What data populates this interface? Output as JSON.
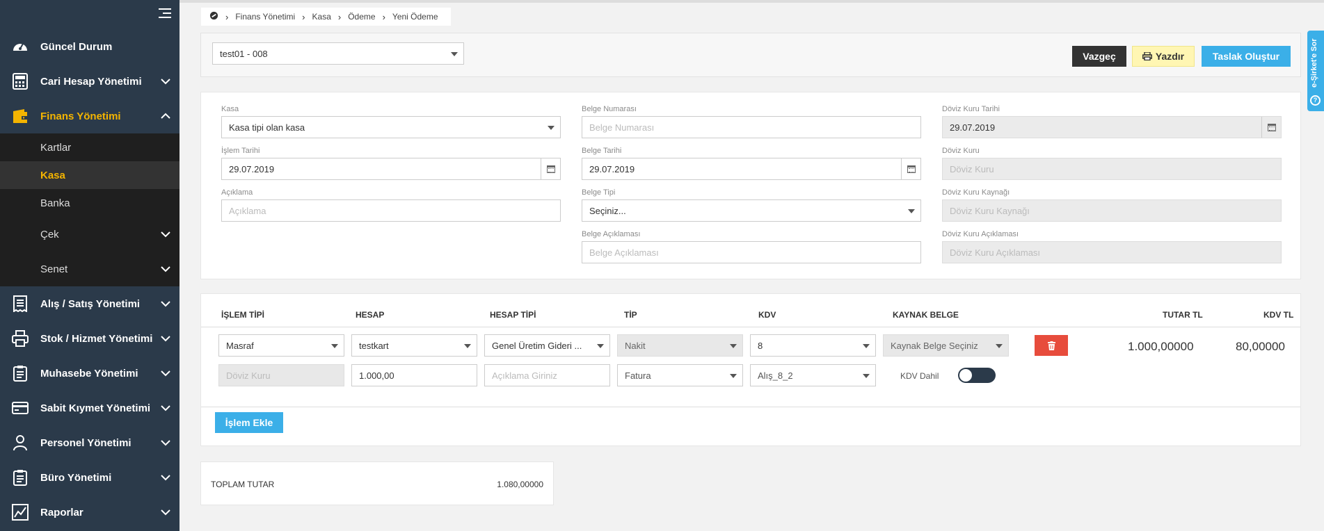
{
  "sidebar": {
    "items": [
      {
        "label": "Güncel Durum",
        "icon": "dashboard-icon"
      },
      {
        "label": "Cari Hesap Yönetimi",
        "icon": "calculator-icon"
      },
      {
        "label": "Finans Yönetimi",
        "icon": "wallet-icon"
      },
      {
        "label": "Alış / Satış Yönetimi",
        "icon": "receipt-icon"
      },
      {
        "label": "Stok / Hizmet Yönetimi",
        "icon": "printer-icon"
      },
      {
        "label": "Muhasebe Yönetimi",
        "icon": "clipboard-icon"
      },
      {
        "label": "Sabit Kıymet Yönetimi",
        "icon": "credit-card-icon"
      },
      {
        "label": "Personel Yönetimi",
        "icon": "user-icon"
      },
      {
        "label": "Büro Yönetimi",
        "icon": "clipboard-icon"
      },
      {
        "label": "Raporlar",
        "icon": "chart-icon"
      }
    ],
    "finans_sub": [
      "Kartlar",
      "Kasa",
      "Banka",
      "Çek",
      "Senet"
    ],
    "active_color": "#f4b400"
  },
  "breadcrumb": [
    "Finans Yönetimi",
    "Kasa",
    "Ödeme",
    "Yeni Ödeme"
  ],
  "toolbar": {
    "doc_select": "test01 - 008",
    "cancel": "Vazgeç",
    "print": "Yazdır",
    "draft": "Taslak Oluştur"
  },
  "side_tab": "e-Şirket'e Sor",
  "form": {
    "kasa_label": "Kasa",
    "kasa_value": "Kasa tipi olan kasa",
    "islem_tarihi_label": "İşlem Tarihi",
    "islem_tarihi_value": "29.07.2019",
    "aciklama_label": "Açıklama",
    "aciklama_placeholder": "Açıklama",
    "belge_no_label": "Belge Numarası",
    "belge_no_placeholder": "Belge Numarası",
    "belge_tarihi_label": "Belge Tarihi",
    "belge_tarihi_value": "29.07.2019",
    "belge_tipi_label": "Belge Tipi",
    "belge_tipi_value": "Seçiniz...",
    "belge_aciklama_label": "Belge Açıklaması",
    "belge_aciklama_placeholder": "Belge Açıklaması",
    "doviz_tarihi_label": "Döviz Kuru Tarihi",
    "doviz_tarihi_value": "29.07.2019",
    "doviz_kuru_label": "Döviz Kuru",
    "doviz_kuru_placeholder": "Döviz Kuru",
    "doviz_kaynak_label": "Döviz Kuru Kaynağı",
    "doviz_kaynak_placeholder": "Döviz Kuru Kaynağı",
    "doviz_aciklama_label": "Döviz Kuru Açıklaması",
    "doviz_aciklama_placeholder": "Döviz Kuru Açıklaması"
  },
  "table": {
    "headers": [
      "İŞLEM TİPİ",
      "HESAP",
      "HESAP TİPİ",
      "TİP",
      "KDV",
      "KAYNAK BELGE",
      "TUTAR TL",
      "KDV TL"
    ],
    "row1": {
      "islem_tipi": "Masraf",
      "hesap": "testkart",
      "hesap_tipi": "Genel Üretim Gideri ...",
      "tip": "Nakit",
      "kdv": "8",
      "kaynak_belge": "Kaynak Belge Seçiniz",
      "tutar": "1.000,00000",
      "kdv_tl": "80,00000"
    },
    "row2": {
      "doviz_kuru_placeholder": "Döviz Kuru",
      "amount": "1.000,00",
      "aciklama_placeholder": "Açıklama Giriniz",
      "belge_turu": "Fatura",
      "kdv_kodu": "Alış_8_2",
      "kdv_dahil_label": "KDV Dahil"
    },
    "add_button": "İşlem Ekle"
  },
  "totals": {
    "label": "TOPLAM TUTAR",
    "value": "1.080,00000"
  }
}
